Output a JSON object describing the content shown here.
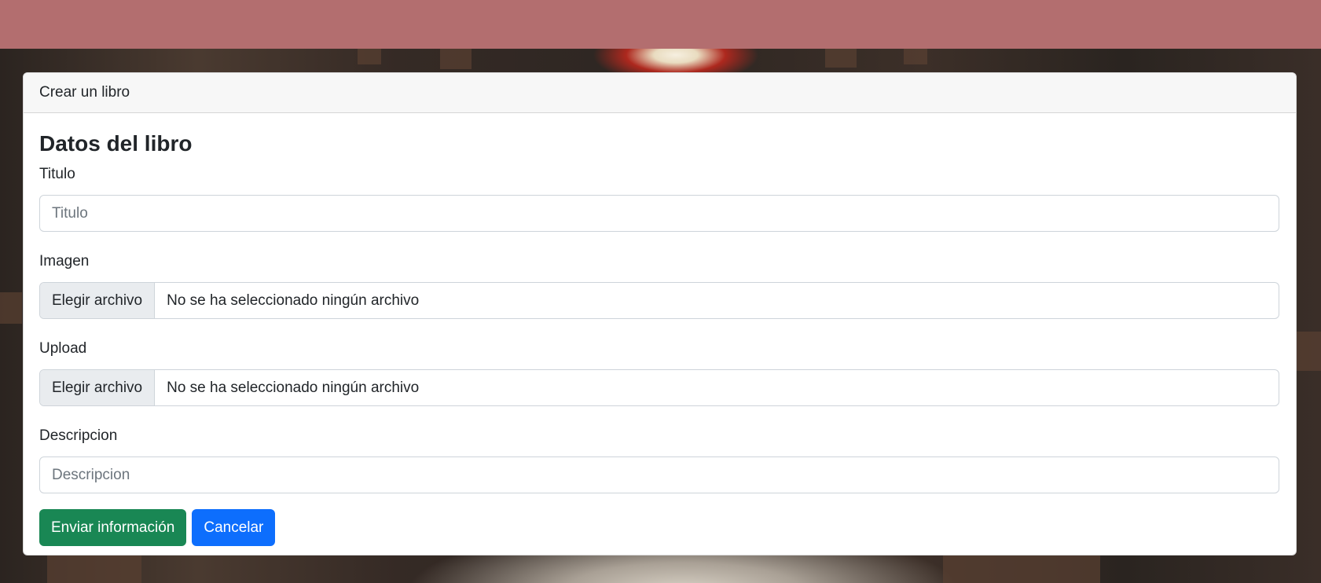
{
  "colors": {
    "topbar": "#b36e6f",
    "success": "#198754",
    "primary": "#0d6efd"
  },
  "card": {
    "header": "Crear un libro",
    "title": "Datos del libro"
  },
  "form": {
    "titulo": {
      "label": "Titulo",
      "placeholder": "Titulo"
    },
    "imagen": {
      "label": "Imagen",
      "button": "Elegir archivo",
      "status": "No se ha seleccionado ningún archivo"
    },
    "upload": {
      "label": "Upload",
      "button": "Elegir archivo",
      "status": "No se ha seleccionado ningún archivo"
    },
    "descripcion": {
      "label": "Descripcion",
      "placeholder": "Descripcion"
    }
  },
  "actions": {
    "submit": "Enviar información",
    "cancel": "Cancelar"
  }
}
